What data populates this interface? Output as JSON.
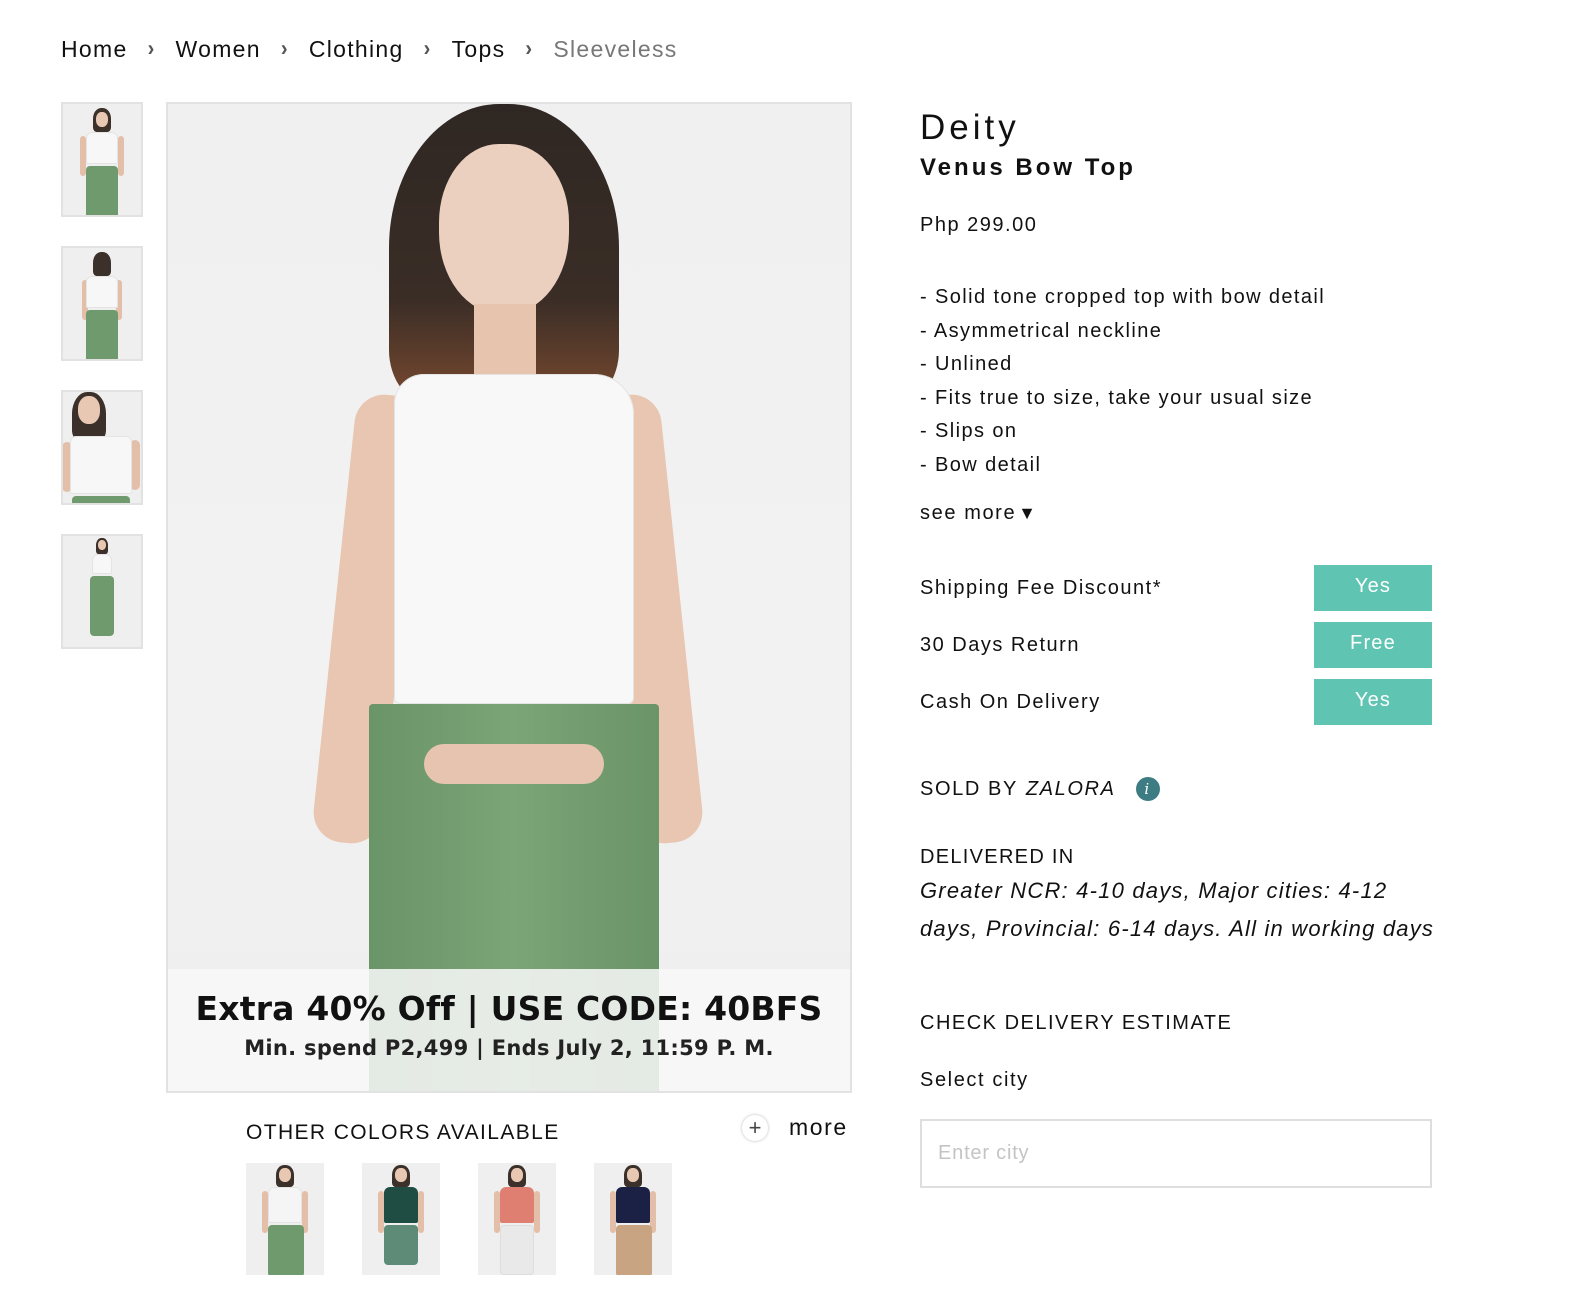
{
  "breadcrumb": [
    {
      "label": "Home"
    },
    {
      "label": "Women"
    },
    {
      "label": "Clothing"
    },
    {
      "label": "Tops"
    },
    {
      "label": "Sleeveless",
      "current": true
    }
  ],
  "breadcrumb_separator": "›",
  "gallery": {
    "thumbnails": [
      {
        "alt": "Front view",
        "top_color": "#f7f7f7",
        "bottom_color": "#6f9a6e"
      },
      {
        "alt": "Back view",
        "top_color": "#f7f7f7",
        "bottom_color": "#6f9a6e"
      },
      {
        "alt": "Close-up view",
        "top_color": "#f7f7f7",
        "bottom_color": "#6f9a6e"
      },
      {
        "alt": "Full-length view",
        "top_color": "#f7f7f7",
        "bottom_color": "#6f9a6e"
      }
    ],
    "promo": {
      "title": "Extra 40% Off | USE CODE: 40BFS",
      "subtitle": "Min. spend P2,499 | Ends July 2, 11:59 P. M."
    }
  },
  "other_colors": {
    "title": "OTHER COLORS AVAILABLE",
    "more_icon": "plus-circle-icon",
    "more_label": "more",
    "items": [
      {
        "name": "White",
        "top_color": "#f5f5f5",
        "bottom_color": "#6f9a6e"
      },
      {
        "name": "Green",
        "top_color": "#1f4d44",
        "bottom_color": "#5e8b78"
      },
      {
        "name": "Pink",
        "top_color": "#df7f72",
        "bottom_color": "#eeeeee"
      },
      {
        "name": "Navy",
        "top_color": "#1b2145",
        "bottom_color": "#c8a483"
      }
    ]
  },
  "product": {
    "brand": "Deity",
    "name": "Venus Bow Top",
    "price": "Php 299.00",
    "description": [
      "- Solid tone cropped top with bow detail",
      "- Asymmetrical neckline",
      "- Unlined",
      "- Fits true to size, take your usual size",
      "- Slips on",
      "- Bow detail"
    ],
    "see_more_label": "see more",
    "see_more_icon": "▼"
  },
  "perks": [
    {
      "label": "Shipping Fee Discount*",
      "value": "Yes"
    },
    {
      "label": "30 Days Return",
      "value": "Free"
    },
    {
      "label": "Cash On Delivery",
      "value": "Yes"
    }
  ],
  "seller": {
    "prefix": "SOLD BY",
    "name": "ZALORA",
    "info_icon": "i"
  },
  "delivery": {
    "title": "DELIVERED IN",
    "text": "Greater NCR: 4-10 days, Major cities: 4-12 days, Provincial: 6-14 days. All in working days"
  },
  "delivery_estimate": {
    "title": "CHECK DELIVERY ESTIMATE",
    "city_label": "Select city",
    "city_placeholder": "Enter city",
    "city_value": ""
  },
  "colors": {
    "accent": "#5fc4b1",
    "info_icon": "#3e7c84",
    "breadcrumb_current": "#777777"
  }
}
